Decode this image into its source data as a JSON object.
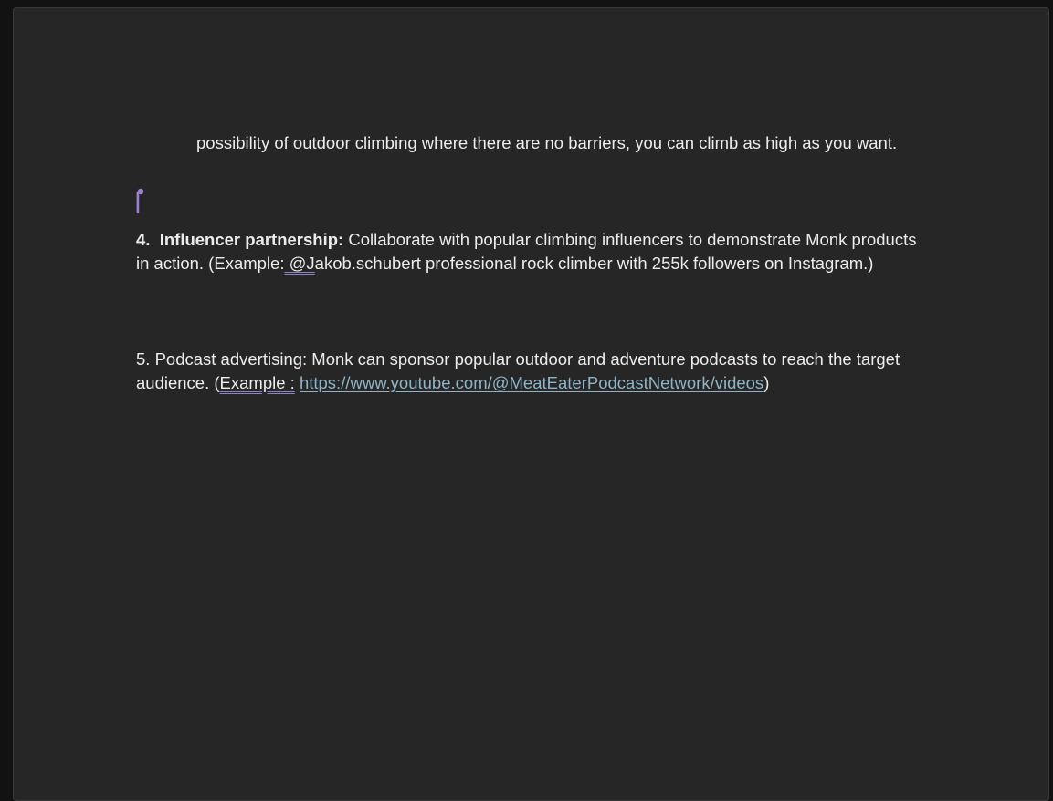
{
  "document": {
    "paragraph_continuation": "possibility of outdoor climbing where there are no barriers, you can climb as high as you want.",
    "item4": {
      "number": "4.",
      "heading": "Influencer partnership:",
      "text_before": " Collaborate with popular climbing influencers to demonstrate Monk products in action. (",
      "example_label": "Example:",
      "space": " ",
      "handle": "@J",
      "text_after": "akob.schubert professional rock climber with 255k followers on Instagram.)"
    },
    "item5": {
      "text_before": "5. Podcast advertising: Monk can sponsor popular outdoor and adventure podcasts to reach the target audience. (",
      "example_label": "Example :",
      "space": " ",
      "link_text": "https://www.youtube.com/@MeatEaterPodcastNetwork/videos",
      "text_after": ")"
    }
  },
  "colors": {
    "page_background": "#262626",
    "text": "#ececec",
    "link": "#8fb4c8",
    "spellcheck_underline": "#8a84c9",
    "cursor": "#9b7fd0"
  },
  "icons": {
    "cursor": "text-cursor-icon"
  }
}
